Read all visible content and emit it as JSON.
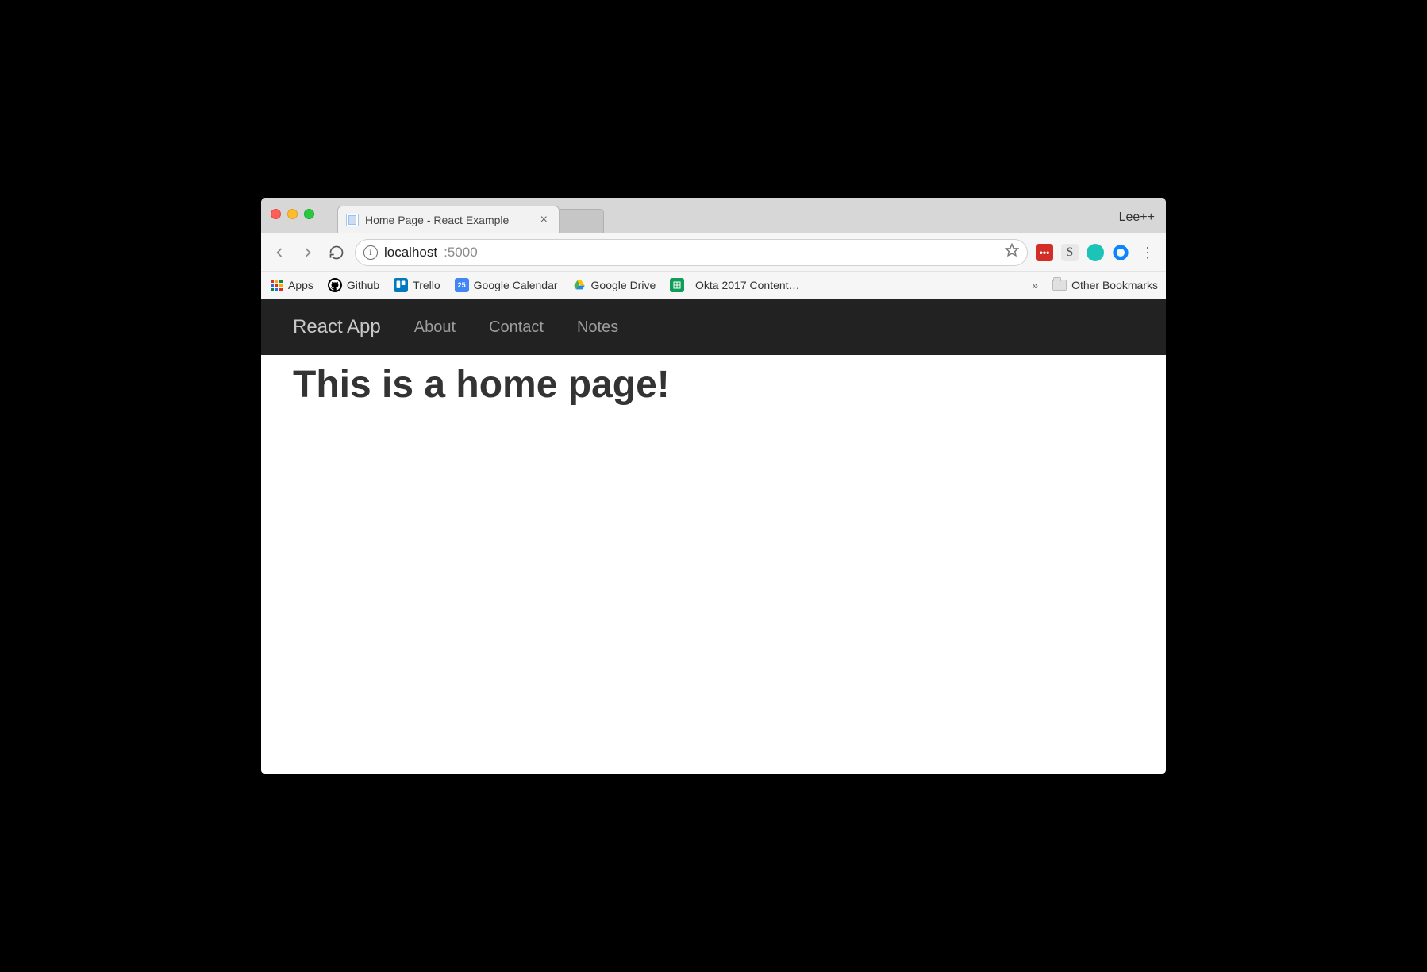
{
  "browser": {
    "tab_title": "Home Page - React Example",
    "profile_name": "Lee++",
    "url": {
      "host": "localhost",
      "port": ":5000"
    },
    "bookmarks": [
      {
        "label": "Apps",
        "icon": "apps"
      },
      {
        "label": "Github",
        "icon": "github"
      },
      {
        "label": "Trello",
        "icon": "trello"
      },
      {
        "label": "Google Calendar",
        "icon": "gcal",
        "day": "25"
      },
      {
        "label": "Google Drive",
        "icon": "gdrive"
      },
      {
        "label": "_Okta 2017 Content…",
        "icon": "sheets"
      }
    ],
    "other_bookmarks_label": "Other Bookmarks",
    "overflow": "»"
  },
  "app": {
    "brand": "React App",
    "nav": [
      {
        "label": "About"
      },
      {
        "label": "Contact"
      },
      {
        "label": "Notes"
      }
    ],
    "heading": "This is a home page!"
  }
}
